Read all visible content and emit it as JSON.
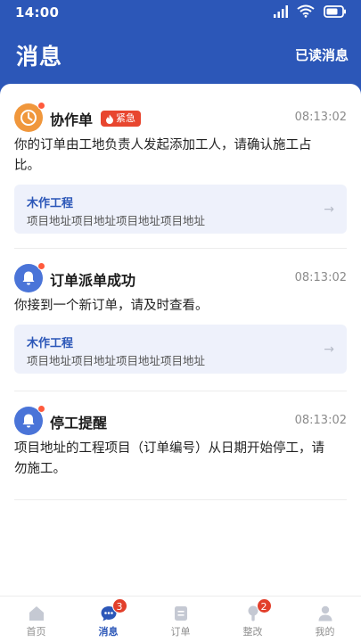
{
  "status": {
    "time": "14:00"
  },
  "header": {
    "title": "消息",
    "action": "已读消息"
  },
  "messages": [
    {
      "title": "协作单",
      "badge": "紧急",
      "time": "08:13:02",
      "text": [
        "你的订单由工地负责人发起添加工人，请确认施工占",
        "比。"
      ],
      "card": {
        "title": "木作工程",
        "address": "项目地址项目地址项目地址项目地址"
      },
      "icon": "clock-icon",
      "color": "#f0973c"
    },
    {
      "title": "订单派单成功",
      "time": "08:13:02",
      "text": [
        "你接到一个新订单，请及时查看。"
      ],
      "card": {
        "title": "木作工程",
        "address": "项目地址项目地址项目地址项目地址"
      },
      "icon": "bell-icon",
      "color": "#4a74d8"
    },
    {
      "title": "停工提醒",
      "time": "08:13:02",
      "text": [
        "项目地址的工程项目（订单编号）从日期开始停工，请",
        "勿施工。"
      ],
      "icon": "bell-icon",
      "color": "#4a74d8"
    }
  ],
  "tabs": [
    {
      "label": "首页",
      "icon": "home-icon"
    },
    {
      "label": "消息",
      "icon": "chat-icon",
      "badge": "3"
    },
    {
      "label": "订单",
      "icon": "document-icon"
    },
    {
      "label": "整改",
      "icon": "wrench-icon",
      "badge": "2"
    },
    {
      "label": "我的",
      "icon": "user-icon"
    }
  ],
  "colors": {
    "primary": "#2c57b8",
    "urgent": "#e8462f",
    "card_bg": "#eef1fb"
  }
}
